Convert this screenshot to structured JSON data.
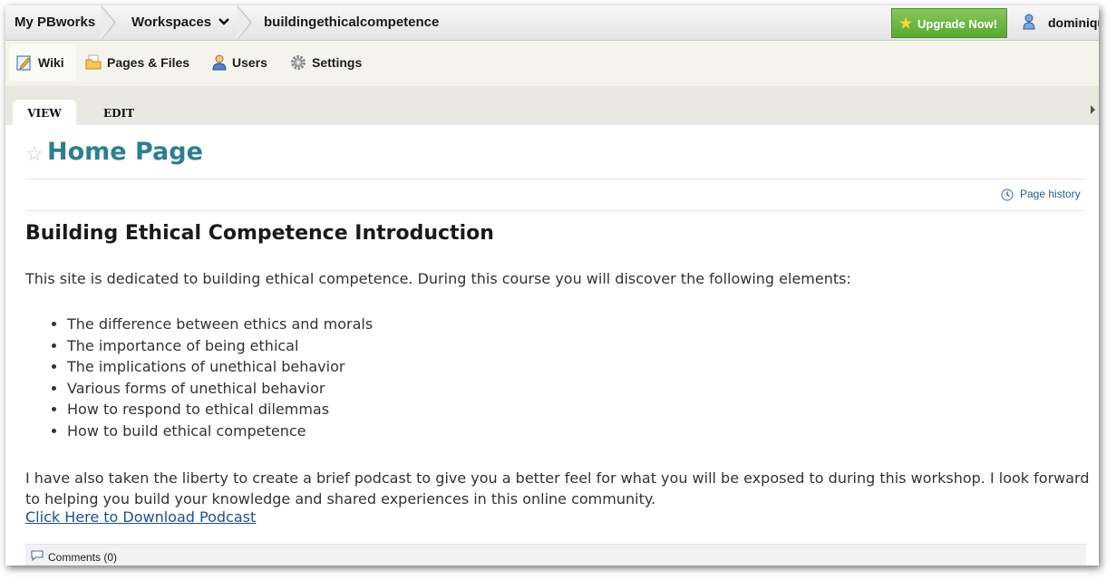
{
  "topbar": {
    "my_pbworks": "My PBworks",
    "workspaces": "Workspaces",
    "workspace_name": "buildingethicalcompetence",
    "upgrade_label": "Upgrade Now!",
    "user_name": "dominiqu",
    "upgrade_color": "#6cb840"
  },
  "nav": {
    "tabs": [
      {
        "label": "Wiki",
        "icon": "wiki-edit-icon"
      },
      {
        "label": "Pages & Files",
        "icon": "folder-icon"
      },
      {
        "label": "Users",
        "icon": "user-icon"
      },
      {
        "label": "Settings",
        "icon": "gear-icon"
      }
    ]
  },
  "modes": {
    "view": "VIEW",
    "edit": "EDIT"
  },
  "page": {
    "title": "Home Page",
    "history_label": "Page history",
    "heading": "Building Ethical Competence Introduction",
    "intro": "This site is dedicated to building ethical competence. During this course you will discover the following elements:",
    "items": [
      "The difference between ethics and morals",
      "The importance of being ethical",
      "The implications of unethical behavior",
      "Various forms of unethical behavior",
      "How to respond to ethical dilemmas",
      "How to build ethical competence"
    ],
    "outro": "I have also taken the liberty to create a brief podcast to give you a better feel for what you will be exposed to during this workshop. I look forward to helping you build your knowledge and shared experiences in this online community.",
    "podcast_link": "Click Here to Download Podcast",
    "comments_label": "Comments (0)",
    "title_color": "#2b7f93",
    "link_color": "#1a4f9a"
  }
}
